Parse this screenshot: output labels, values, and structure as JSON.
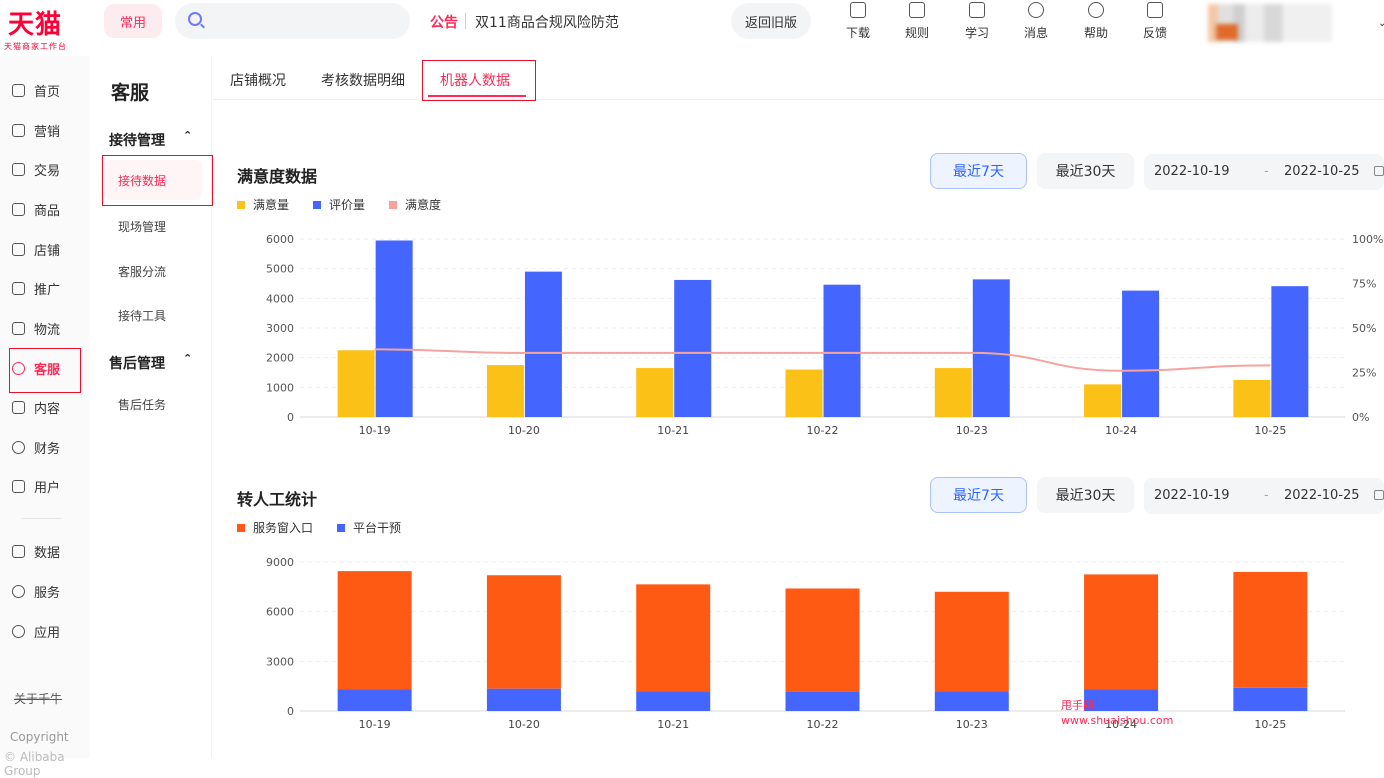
{
  "brand": {
    "logo": "天猫",
    "sub": "天猫商家工作台",
    "color": "#ff0036"
  },
  "topbar": {
    "common_label": "常用",
    "search_placeholder": "",
    "notice_tag": "公告",
    "notice_text": "双11商品合规风险防范",
    "old_version_label": "返回旧版",
    "icons": [
      {
        "label": "下载",
        "icon": "download-icon"
      },
      {
        "label": "规则",
        "icon": "book-icon"
      },
      {
        "label": "学习",
        "icon": "learn-icon"
      },
      {
        "label": "消息",
        "icon": "message-icon"
      },
      {
        "label": "帮助",
        "icon": "help-icon"
      },
      {
        "label": "反馈",
        "icon": "feedback-icon"
      }
    ]
  },
  "leftnav": {
    "items": [
      {
        "label": "首页",
        "icon": "home-icon"
      },
      {
        "label": "营销",
        "icon": "megaphone-icon"
      },
      {
        "label": "交易",
        "icon": "trade-icon"
      },
      {
        "label": "商品",
        "icon": "product-icon"
      },
      {
        "label": "店铺",
        "icon": "shop-icon"
      },
      {
        "label": "推广",
        "icon": "promote-icon"
      },
      {
        "label": "物流",
        "icon": "logistics-icon"
      },
      {
        "label": "客服",
        "icon": "headset-icon",
        "active": true
      },
      {
        "label": "内容",
        "icon": "content-icon"
      },
      {
        "label": "财务",
        "icon": "finance-icon"
      },
      {
        "label": "用户",
        "icon": "user-icon"
      },
      {
        "label": "数据",
        "icon": "data-icon"
      },
      {
        "label": "服务",
        "icon": "service-icon"
      },
      {
        "label": "应用",
        "icon": "app-icon"
      }
    ],
    "about": "关于千牛",
    "copyright": "Copyright",
    "copyright2": "© Alibaba Group"
  },
  "subnav": {
    "title": "客服",
    "group1": "接待管理",
    "group1_items": [
      "接待数据",
      "现场管理",
      "客服分流",
      "接待工具"
    ],
    "group2": "售后管理",
    "group2_items": [
      "售后任务"
    ]
  },
  "tabs": [
    "店铺概况",
    "考核数据明细",
    "机器人数据"
  ],
  "active_tab": 2,
  "panel1": {
    "title": "满意度数据",
    "btn_7": "最近7天",
    "btn_30": "最近30天",
    "date_from": "2022-10-19",
    "date_sep": "-",
    "date_to": "2022-10-25"
  },
  "panel2": {
    "title": "转人工统计",
    "btn_7": "最近7天",
    "btn_30": "最近30天",
    "date_from": "2022-10-19",
    "date_sep": "-",
    "date_to": "2022-10-25"
  },
  "chart_data": [
    {
      "type": "bar",
      "categories": [
        "10-19",
        "10-20",
        "10-21",
        "10-22",
        "10-23",
        "10-24",
        "10-25"
      ],
      "series": [
        {
          "name": "满意量",
          "values": [
            2250,
            1750,
            1650,
            1600,
            1650,
            1100,
            1250
          ],
          "color": "#fbc117"
        },
        {
          "name": "评价量",
          "values": [
            5950,
            4900,
            4620,
            4460,
            4640,
            4260,
            4410
          ],
          "color": "#4466ff"
        },
        {
          "name": "满意度",
          "type": "line",
          "axis": "right",
          "values": [
            0.38,
            0.36,
            0.36,
            0.36,
            0.36,
            0.26,
            0.29
          ],
          "color": "#f5a39c"
        }
      ],
      "ylim": [
        0,
        6000
      ],
      "yticks": [
        "0",
        "1000",
        "2000",
        "3000",
        "4000",
        "5000",
        "6000"
      ],
      "y2lim": [
        0,
        1
      ],
      "y2ticks": [
        "0%",
        "25%",
        "50%",
        "75%",
        "100%"
      ],
      "legend": "top-left",
      "grid": true
    },
    {
      "type": "bar",
      "stacked": true,
      "categories": [
        "10-19",
        "10-20",
        "10-21",
        "10-22",
        "10-23",
        "10-24",
        "10-25"
      ],
      "series": [
        {
          "name": "服务窗入口",
          "values": [
            7150,
            6850,
            6450,
            6250,
            6000,
            6950,
            7000
          ],
          "color": "#ff5a14"
        },
        {
          "name": "平台干预",
          "values": [
            1300,
            1350,
            1200,
            1150,
            1200,
            1300,
            1400
          ],
          "color": "#4466ff"
        }
      ],
      "ylim": [
        0,
        9000
      ],
      "yticks": [
        "0",
        "3000",
        "6000",
        "9000"
      ],
      "legend": "top-left",
      "grid": true
    }
  ],
  "watermark": {
    "line1": "甩手网",
    "line2": "www.shuaishou.com"
  }
}
